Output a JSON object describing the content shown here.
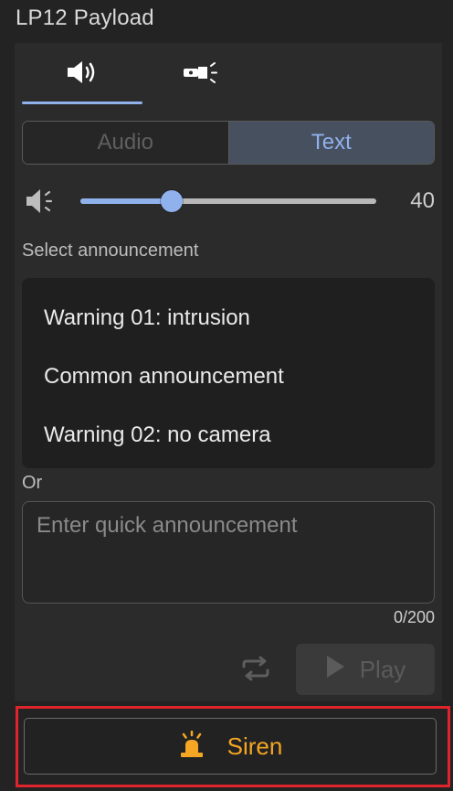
{
  "title": "LP12 Payload",
  "tabs": [
    {
      "icon": "speaker-icon",
      "active": true
    },
    {
      "icon": "spotlight-icon",
      "active": false
    }
  ],
  "mode": {
    "audio_label": "Audio",
    "text_label": "Text",
    "selected": "Text"
  },
  "volume": {
    "value": "40",
    "level": 0.31,
    "icon": "volume-icon"
  },
  "announcement": {
    "label": "Select announcement",
    "items": [
      "Warning 01: intrusion",
      "Common announcement",
      "Warning 02: no camera"
    ]
  },
  "or_label": "Or",
  "quick": {
    "placeholder": "Enter quick announcement",
    "value": "",
    "counter": "0/200"
  },
  "actions": {
    "play_label": "Play",
    "repeat_icon": "repeat-icon"
  },
  "siren": {
    "label": "Siren",
    "icon": "siren-icon"
  },
  "colors": {
    "accent": "#8fb1ec",
    "siren": "#f5a623",
    "highlight": "#e0242c"
  }
}
